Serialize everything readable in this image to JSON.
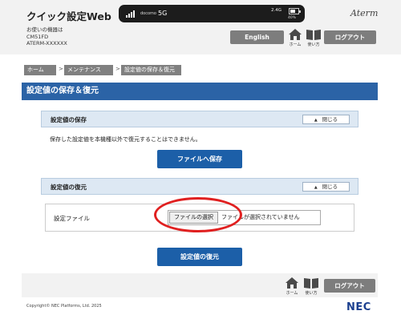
{
  "header": {
    "app_title": "クイック設定Web",
    "device_label": "お使いの機器は",
    "device_model": "CM51FD",
    "device_name": "ATERM-XXXXXX",
    "brand": "Aterm",
    "english_label": "English",
    "home_label": "ホーム",
    "help_label": "使い方",
    "logout_label": "ログアウト"
  },
  "status": {
    "carrier": "docomo",
    "network": "5G",
    "speed": "2.4G",
    "battery_percent": "40%"
  },
  "breadcrumb": [
    "ホーム",
    "メンテナンス",
    "設定値の保存＆復元"
  ],
  "page_title": "設定値の保存＆復元",
  "save_section": {
    "title": "設定値の保存",
    "close_label": "閉じる",
    "note": "保存した設定値を本機種以外で復元することはできません。",
    "save_button": "ファイルへ保存"
  },
  "restore_section": {
    "title": "設定値の復元",
    "close_label": "閉じる",
    "file_label": "設定ファイル",
    "choose_button": "ファイルの選択",
    "file_status": "ファイルが選択されていません",
    "restore_button": "設定値の復元"
  },
  "footer": {
    "home_label": "ホーム",
    "help_label": "使い方",
    "logout_label": "ログアウト",
    "copyright": "Copyright© NEC Platforms, Ltd. 2025",
    "logo": "NEC"
  },
  "colors": {
    "accent_blue": "#1c5fa8",
    "highlight_red": "#e02020"
  }
}
